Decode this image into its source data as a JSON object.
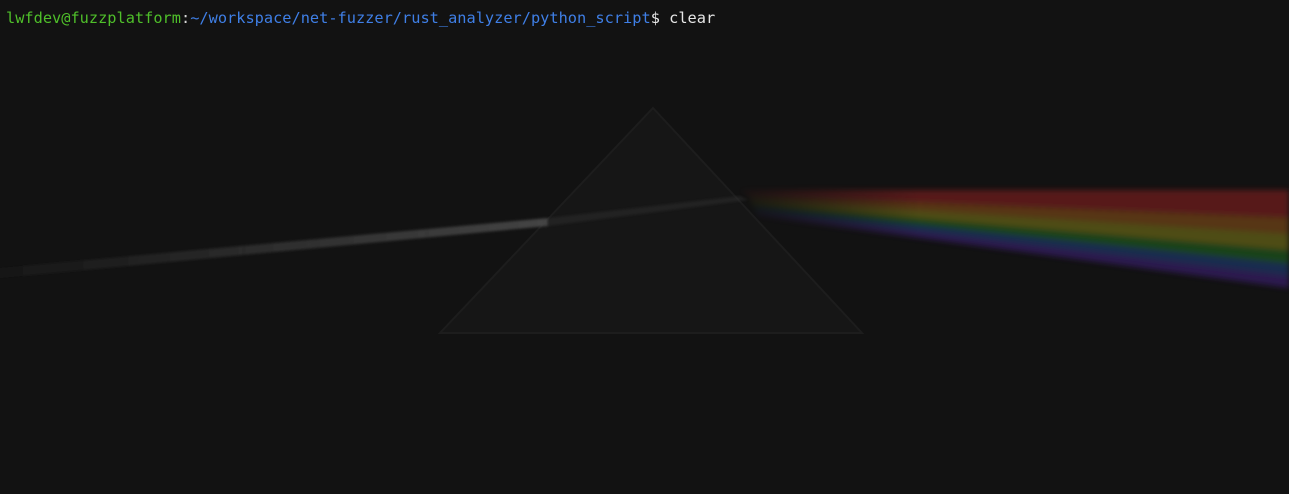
{
  "terminal": {
    "prompt": {
      "user_host": "lwfdev@fuzzplatform",
      "separator": ":",
      "path": "~/workspace/net-fuzzer/rust_analyzer/python_script",
      "symbol": "$ ",
      "command": "clear"
    },
    "colors": {
      "background": "#121212",
      "user_host": "#4fbf2a",
      "path": "#3f7fe6",
      "text": "#e6e6e6"
    },
    "wallpaper": {
      "icon": "prism-spectrum-icon",
      "spectrum_colors": [
        "#7a1f1f",
        "#7a4a14",
        "#6e6a12",
        "#1f5a1f",
        "#1f3a6a",
        "#3a1f6a"
      ]
    }
  }
}
